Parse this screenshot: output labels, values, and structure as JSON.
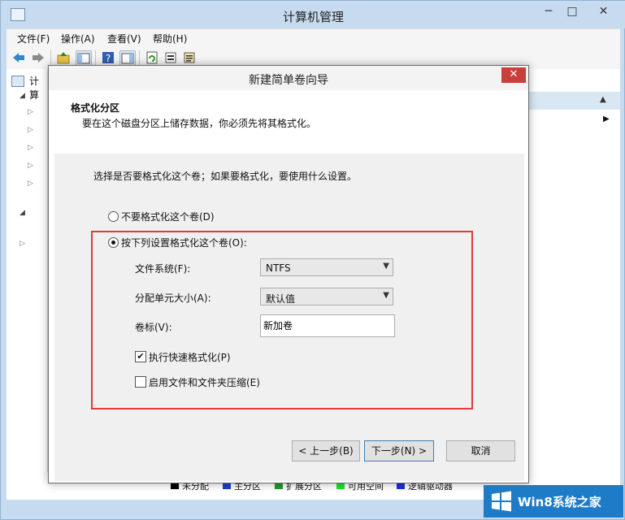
{
  "window": {
    "title": "计算机管理"
  },
  "menu": [
    "文件(F)",
    "操作(A)",
    "查看(V)",
    "帮助(H)"
  ],
  "left_tree": {
    "root_label": "计算"
  },
  "dialog": {
    "title": "新建简单卷向导",
    "heading": "格式化分区",
    "subheading": "要在这个磁盘分区上储存数据，你必须先将其格式化。",
    "question": "选择是否要格式化这个卷；如果要格式化，要使用什么设置。",
    "option_no_format": "不要格式化这个卷(D)",
    "option_format": "按下列设置格式化这个卷(O):",
    "file_system_label": "文件系统(F):",
    "file_system_value": "NTFS",
    "alloc_unit_label": "分配单元大小(A):",
    "alloc_unit_value": "默认值",
    "volume_label_label": "卷标(V):",
    "volume_label_value": "新加卷",
    "quick_format_label": "执行快速格式化(P)",
    "quick_format_checked": true,
    "compression_label": "启用文件和文件夹压缩(E)",
    "compression_checked": false,
    "back_button": "< 上一步(B)",
    "next_button": "下一步(N) >",
    "cancel_button": "取消"
  },
  "legend": [
    {
      "label": "未分配",
      "color": "#000000"
    },
    {
      "label": "主分区",
      "color": "#1c3fd0"
    },
    {
      "label": "扩展分区",
      "color": "#1c9a2e"
    },
    {
      "label": "可用空间",
      "color": "#22e02a"
    },
    {
      "label": "逻辑驱动器",
      "color": "#1c2fe0"
    }
  ],
  "watermark": {
    "text": "Win8系统之家"
  },
  "colors": {
    "highlight_box": "#e03c3c",
    "dialog_close": "#c8403a",
    "watermark_bg": "#1e7bc8"
  }
}
